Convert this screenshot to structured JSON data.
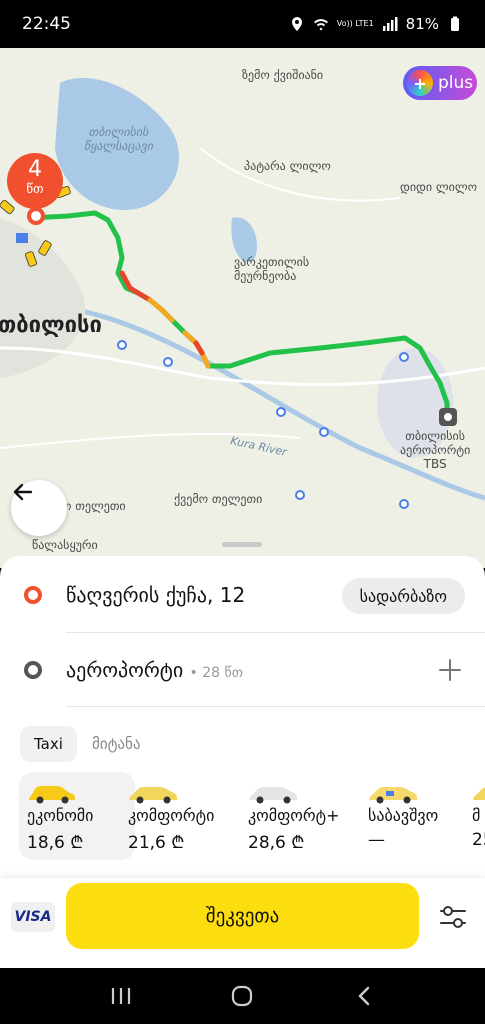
{
  "status": {
    "time": "22:45",
    "network": "Vo)) LTE1",
    "battery": "81%"
  },
  "map": {
    "labels": {
      "zemo_kvishani": "ზემო ქვიშიანი",
      "tbilisi_reservoir": "თბილისის\nწყალსაცავი",
      "patara_lilo": "პატარა ლილო",
      "didi_lilo": "დიდი ლილო",
      "varketili": "ვარკეთილის\nმეურნეობა",
      "city": "თბილისი",
      "airport": "თბილისის\nაეროპორტი\nTBS",
      "kura_river": "Kura River",
      "kvemo_teleti": "ქვემო თელეთი",
      "teleti": "ო თელეთი",
      "tsavkisi": "წალასყური"
    },
    "plus_badge": "plus",
    "eta": {
      "value": "4",
      "unit": "წთ"
    }
  },
  "route": {
    "pickup": "წაღვერის ქუჩა, 12",
    "entrance_button": "სადარბაზო",
    "destination": "აეროპორტი",
    "destination_eta": "• 28 წთ"
  },
  "tabs": [
    {
      "label": "Taxi",
      "active": true
    },
    {
      "label": "მიტანა",
      "active": false
    }
  ],
  "tariffs": [
    {
      "name": "ეკონომი",
      "price": "18,6 ₾",
      "color": "#f7c919",
      "selected": true
    },
    {
      "name": "კომფორტი",
      "price": "21,6 ₾",
      "color": "#f2d65b",
      "selected": false
    },
    {
      "name": "კომფორტ+",
      "price": "28,6 ₾",
      "color": "#e4e4e4",
      "selected": false
    },
    {
      "name": "საბავშვო",
      "price": "—",
      "color": "#f6d96c",
      "selected": false
    },
    {
      "name": "მ",
      "price": "25",
      "color": "#f2d65b",
      "selected": false
    }
  ],
  "payment": {
    "card": "VISA"
  },
  "order_button": "შეკვეთა",
  "colors": {
    "accent": "#fcdd0f",
    "pickup": "#f0502d",
    "route_green": "#22c24a",
    "route_orange": "#f5a623",
    "route_red": "#e8452c"
  }
}
